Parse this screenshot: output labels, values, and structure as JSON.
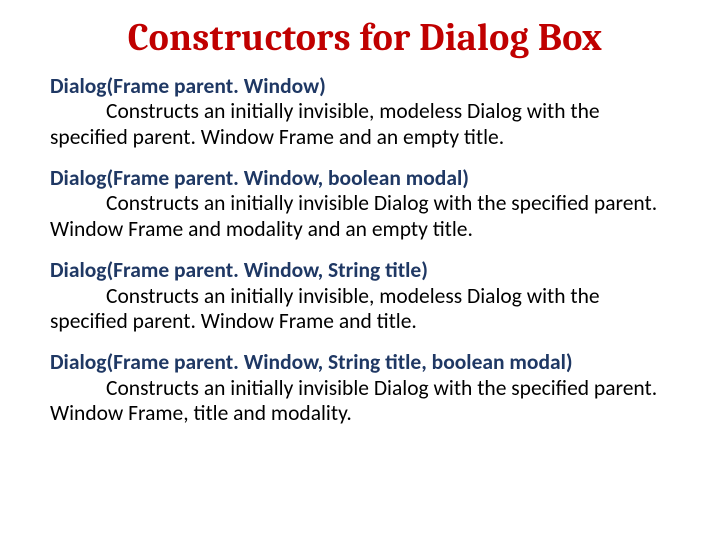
{
  "title": "Constructors for Dialog Box",
  "constructors": [
    {
      "signature": "Dialog(Frame parent. Window)",
      "description_lead": "Constructs an initially invisible, modeless Dialog with the specified parent. Window Frame and an empty title."
    },
    {
      "signature": "Dialog(Frame parent. Window, boolean modal)",
      "description_lead": "Constructs an initially invisible Dialog with the specified parent. Window Frame and modality and an empty title."
    },
    {
      "signature": "Dialog(Frame parent. Window, String title)",
      "description_lead": "Constructs an initially invisible, modeless Dialog with the specified parent. Window Frame and title."
    },
    {
      "signature": "Dialog(Frame parent. Window, String title, boolean modal)",
      "description_lead": "Constructs an initially invisible Dialog with the specified parent. Window Frame, title and modality."
    }
  ]
}
